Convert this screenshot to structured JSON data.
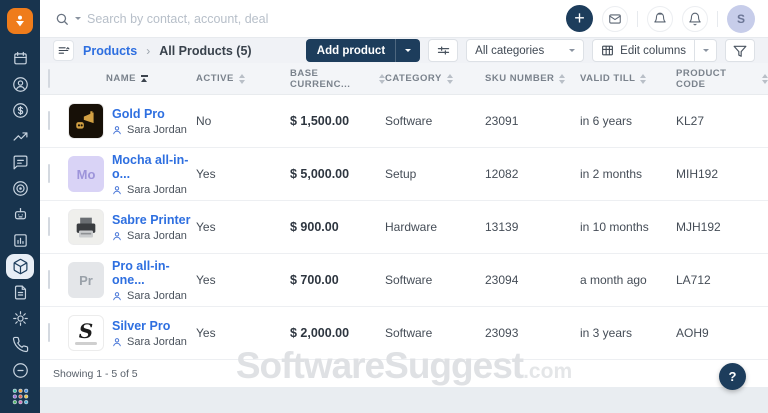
{
  "topbar": {
    "search_placeholder": "Search by contact, account, deal",
    "avatar_initial": "S",
    "icons": [
      "plus-icon",
      "mail-icon",
      "campaign-icon",
      "bell-icon"
    ]
  },
  "breadcrumb": {
    "section": "Products",
    "separator": "›",
    "current": "All Products (5)"
  },
  "toolbar": {
    "add_product_label": "Add product",
    "categories_value": "All categories",
    "edit_columns_label": "Edit columns",
    "icons": [
      "sliders-icon",
      "table-icon",
      "funnel-icon"
    ]
  },
  "sidebar": {
    "items": [
      {
        "name": "calendar",
        "active": false
      },
      {
        "name": "contacts",
        "active": false
      },
      {
        "name": "deals",
        "active": false
      },
      {
        "name": "analytics",
        "active": false
      },
      {
        "name": "conversations",
        "active": false
      },
      {
        "name": "goals",
        "active": false
      },
      {
        "name": "bot",
        "active": false
      },
      {
        "name": "reports",
        "active": false
      },
      {
        "name": "products",
        "active": true
      },
      {
        "name": "invoices",
        "active": false
      },
      {
        "name": "settings",
        "active": false
      },
      {
        "name": "calls",
        "active": false
      },
      {
        "name": "help",
        "active": false
      },
      {
        "name": "apps",
        "active": false
      }
    ]
  },
  "table": {
    "columns": [
      {
        "label": "NAME",
        "sorted": true
      },
      {
        "label": "ACTIVE",
        "sorted": false
      },
      {
        "label": "BASE CURRENC...",
        "sorted": false
      },
      {
        "label": "CATEGORY",
        "sorted": false
      },
      {
        "label": "SKU NUMBER",
        "sorted": false
      },
      {
        "label": "VALID TILL",
        "sorted": false
      },
      {
        "label": "PRODUCT CODE",
        "sorted": false
      }
    ],
    "rows": [
      {
        "name": "Gold Pro",
        "owner": "Sara Jordan",
        "active": "No",
        "price": "$ 1,500.00",
        "category": "Software",
        "sku": "23091",
        "valid_till": "in 6 years",
        "code": "KL27",
        "thumb": {
          "kind": "gold-art",
          "label": "",
          "bg": "#171007",
          "fg": "#d2a043"
        }
      },
      {
        "name": "Mocha all-in-o...",
        "owner": "Sara Jordan",
        "active": "Yes",
        "price": "$ 5,000.00",
        "category": "Setup",
        "sku": "12082",
        "valid_till": "in 2 months",
        "code": "MIH192",
        "thumb": {
          "kind": "initials",
          "label": "Mo",
          "bg": "#d9d3f6",
          "fg": "#9d94da"
        }
      },
      {
        "name": "Sabre Printer",
        "owner": "Sara Jordan",
        "active": "Yes",
        "price": "$ 900.00",
        "category": "Hardware",
        "sku": "13139",
        "valid_till": "in 10 months",
        "code": "MJH192",
        "thumb": {
          "kind": "printer-art",
          "label": "",
          "bg": "#efefec",
          "fg": "#3a3d40"
        }
      },
      {
        "name": "Pro all-in-one...",
        "owner": "Sara Jordan",
        "active": "Yes",
        "price": "$ 700.00",
        "category": "Software",
        "sku": "23094",
        "valid_till": "a month ago",
        "code": "LA712",
        "thumb": {
          "kind": "initials",
          "label": "Pr",
          "bg": "#e4e6e9",
          "fg": "#9aa1a9"
        }
      },
      {
        "name": "Silver Pro",
        "owner": "Sara Jordan",
        "active": "Yes",
        "price": "$ 2,000.00",
        "category": "Software",
        "sku": "23093",
        "valid_till": "in 3 years",
        "code": "AOH9",
        "thumb": {
          "kind": "silver-art",
          "label": "S",
          "bg": "#ffffff",
          "fg": "#1c1c1c"
        }
      }
    ]
  },
  "footer": {
    "showing_text": "Showing 1 - 5 of 5"
  },
  "watermark": {
    "main": "SoftwareSuggest",
    "suffix": ".com"
  },
  "help": {
    "label": "?"
  },
  "colors": {
    "accent_blue": "#2e6fe0",
    "navy": "#1d3d5c",
    "sidebar": "#18344e",
    "logo_orange": "#ef7c1b",
    "toolbar_bg": "#f0f2f6",
    "header_bg": "#f3f5f8"
  }
}
